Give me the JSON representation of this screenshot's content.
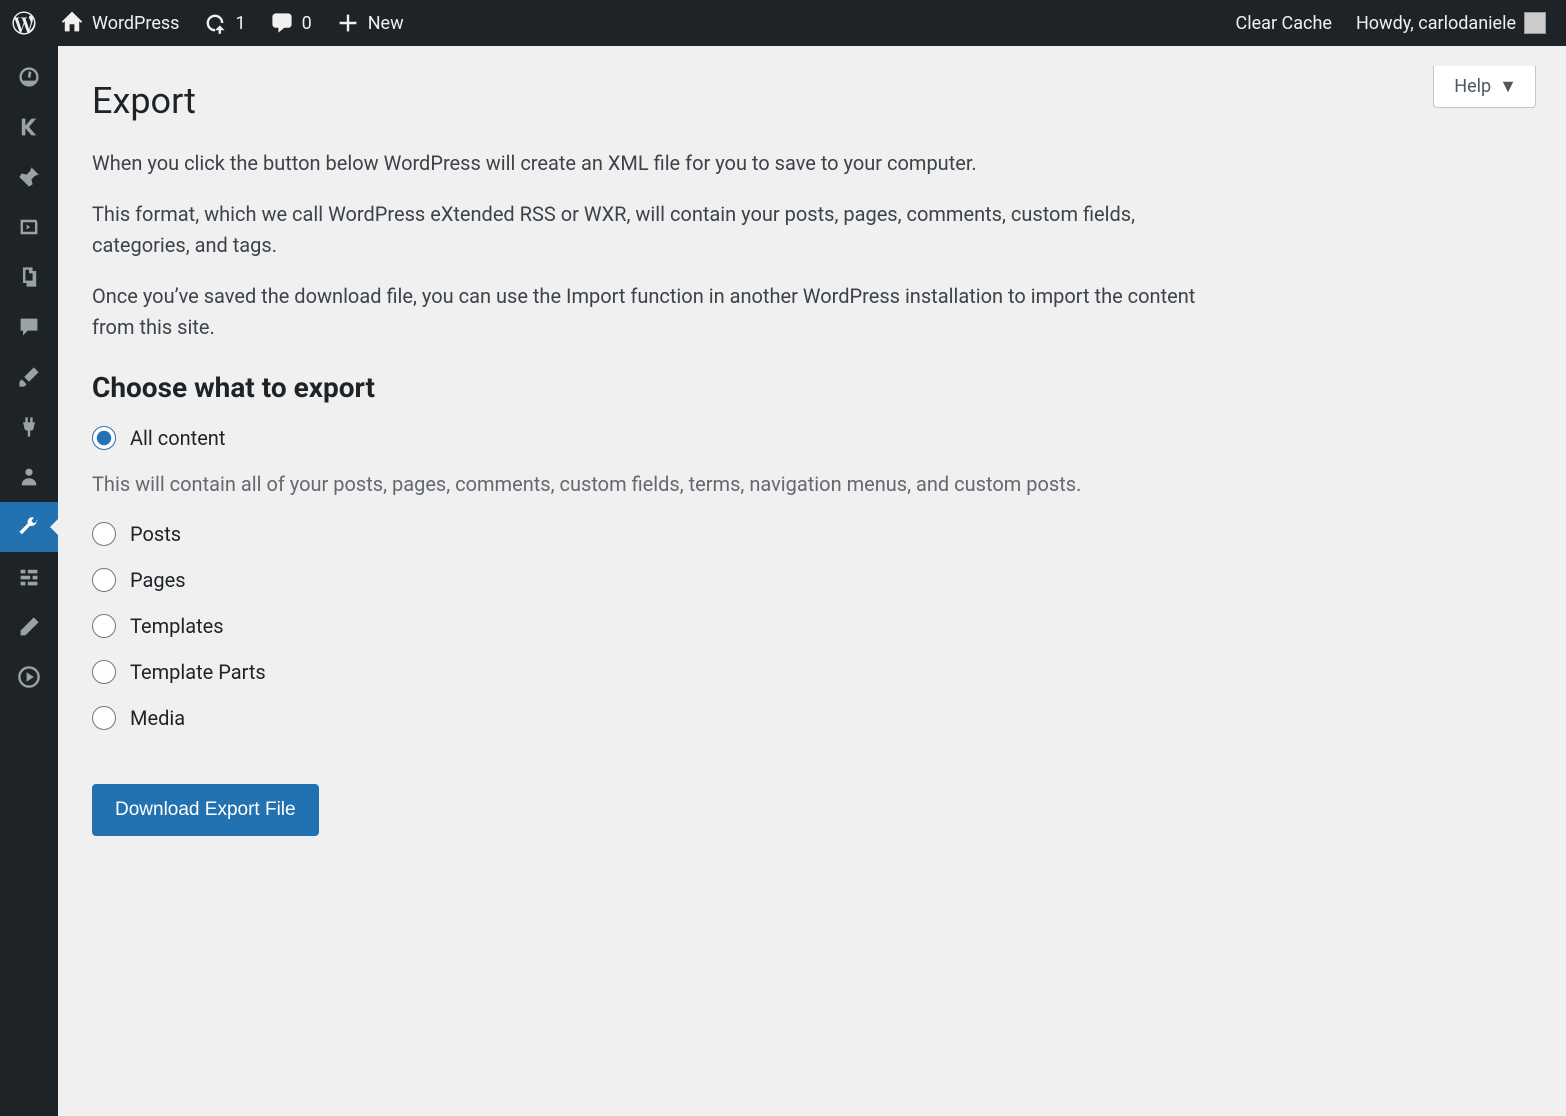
{
  "adminbar": {
    "site_name": "WordPress",
    "updates_count": "1",
    "comments_count": "0",
    "new_label": "New",
    "clear_cache": "Clear Cache",
    "howdy": "Howdy, carlodaniele"
  },
  "help_tab": "Help",
  "page": {
    "title": "Export",
    "p1": "When you click the button below WordPress will create an XML file for you to save to your computer.",
    "p2": "This format, which we call WordPress eXtended RSS or WXR, will contain your posts, pages, comments, custom fields, categories, and tags.",
    "p3": "Once you’ve saved the download file, you can use the Import function in another WordPress installation to import the content from this site.",
    "section_heading": "Choose what to export"
  },
  "options": {
    "all_content": "All content",
    "all_content_hint": "This will contain all of your posts, pages, comments, custom fields, terms, navigation menus, and custom posts.",
    "posts": "Posts",
    "pages": "Pages",
    "templates": "Templates",
    "template_parts": "Template Parts",
    "media": "Media"
  },
  "download_button": "Download Export File"
}
